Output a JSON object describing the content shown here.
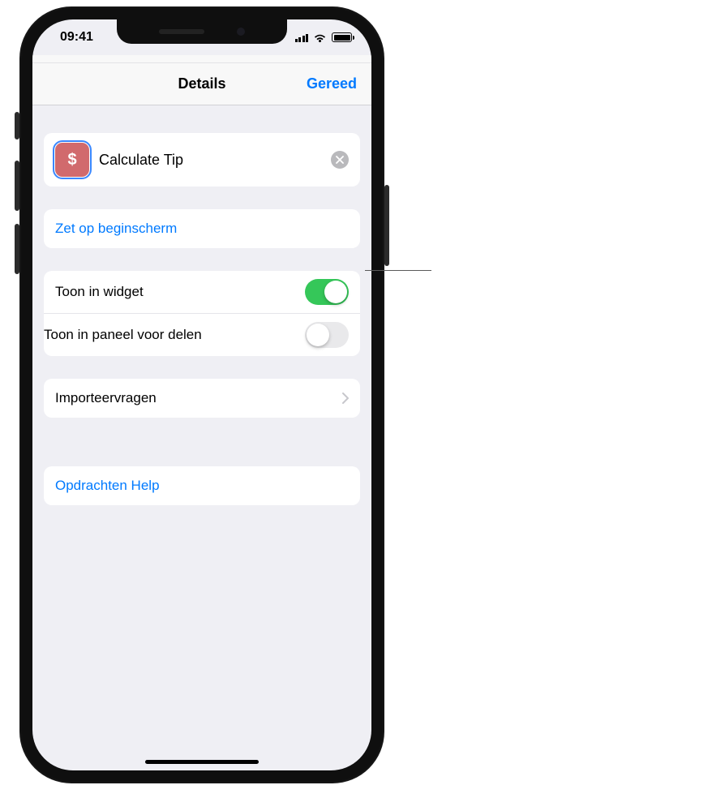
{
  "status": {
    "time": "09:41"
  },
  "nav": {
    "title": "Details",
    "done": "Gereed"
  },
  "shortcut": {
    "name": "Calculate Tip",
    "icon": "dollar-icon",
    "icon_bg": "#d16a6d"
  },
  "actions": {
    "add_to_home": "Zet op beginscherm",
    "help": "Opdrachten Help"
  },
  "toggles": {
    "show_in_widget": {
      "label": "Toon in widget",
      "on": true
    },
    "show_in_share": {
      "label": "Toon in paneel voor delen",
      "on": false
    }
  },
  "import_questions": {
    "label": "Importeervragen"
  }
}
